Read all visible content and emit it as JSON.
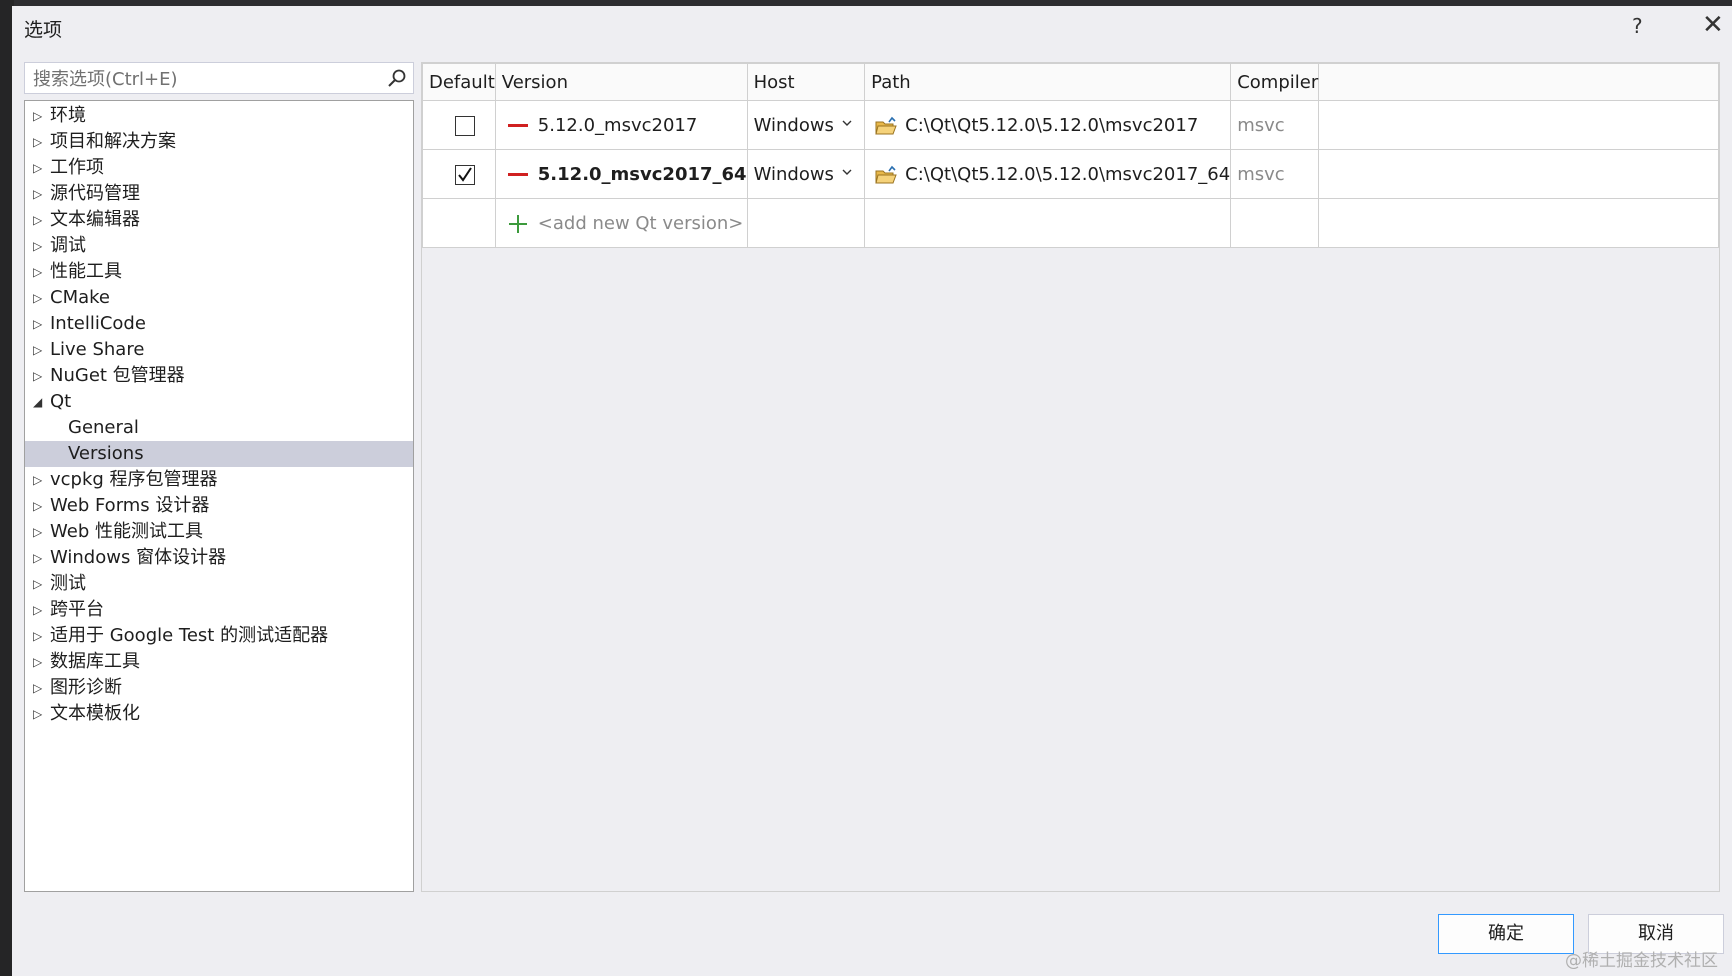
{
  "dialog": {
    "title": "选项",
    "help_label": "?",
    "close_label": "✕"
  },
  "search": {
    "placeholder": "搜索选项(Ctrl+E)"
  },
  "tree": {
    "items": [
      {
        "label": "环境",
        "arrow": "▷"
      },
      {
        "label": "项目和解决方案",
        "arrow": "▷"
      },
      {
        "label": "工作项",
        "arrow": "▷"
      },
      {
        "label": "源代码管理",
        "arrow": "▷"
      },
      {
        "label": "文本编辑器",
        "arrow": "▷"
      },
      {
        "label": "调试",
        "arrow": "▷"
      },
      {
        "label": "性能工具",
        "arrow": "▷"
      },
      {
        "label": "CMake",
        "arrow": "▷"
      },
      {
        "label": "IntelliCode",
        "arrow": "▷"
      },
      {
        "label": "Live Share",
        "arrow": "▷"
      },
      {
        "label": "NuGet 包管理器",
        "arrow": "▷"
      },
      {
        "label": "Qt",
        "arrow": "◢"
      },
      {
        "label": "General",
        "arrow": ""
      },
      {
        "label": "Versions",
        "arrow": ""
      },
      {
        "label": "vcpkg 程序包管理器",
        "arrow": "▷"
      },
      {
        "label": "Web Forms 设计器",
        "arrow": "▷"
      },
      {
        "label": "Web 性能测试工具",
        "arrow": "▷"
      },
      {
        "label": "Windows 窗体设计器",
        "arrow": "▷"
      },
      {
        "label": "测试",
        "arrow": "▷"
      },
      {
        "label": "跨平台",
        "arrow": "▷"
      },
      {
        "label": "适用于 Google Test 的测试适配器",
        "arrow": "▷"
      },
      {
        "label": "数据库工具",
        "arrow": "▷"
      },
      {
        "label": "图形诊断",
        "arrow": "▷"
      },
      {
        "label": "文本模板化",
        "arrow": "▷"
      }
    ],
    "selected": "Versions"
  },
  "grid": {
    "headers": {
      "default": "Default",
      "version": "Version",
      "host": "Host",
      "path": "Path",
      "compiler": "Compiler"
    },
    "rows": [
      {
        "default": false,
        "version": "5.12.0_msvc2017",
        "host": "Windows",
        "path": "C:\\Qt\\Qt5.12.0\\5.12.0\\msvc2017",
        "compiler": "msvc"
      },
      {
        "default": true,
        "version": "5.12.0_msvc2017_64",
        "host": "Windows",
        "path": "C:\\Qt\\Qt5.12.0\\5.12.0\\msvc2017_64",
        "compiler": "msvc"
      }
    ],
    "add_row_label": "<add new Qt version>"
  },
  "buttons": {
    "ok": "确定",
    "cancel": "取消"
  },
  "watermark": "@稀土掘金技术社区",
  "colors": {
    "selection": "#cccedb",
    "remove_icon": "#d02020",
    "add_icon": "#3c9a3c",
    "ok_border": "#3399ff"
  }
}
